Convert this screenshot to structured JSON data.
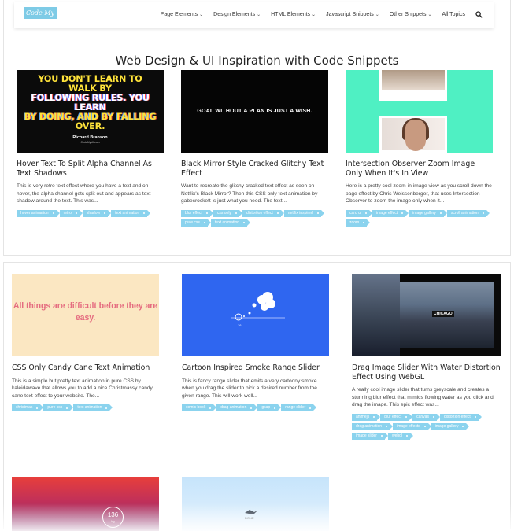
{
  "nav": {
    "logo": "Code My UI",
    "items": [
      {
        "label": "Page Elements",
        "dropdown": true
      },
      {
        "label": "Design Elements",
        "dropdown": true
      },
      {
        "label": "HTML Elements",
        "dropdown": true
      },
      {
        "label": "Javascript Snippets",
        "dropdown": true
      },
      {
        "label": "Other Snippets",
        "dropdown": true
      },
      {
        "label": "All Topics",
        "dropdown": false
      }
    ],
    "search_icon": "search-icon"
  },
  "page_title": "Web Design & UI Inspiration with Code Snippets",
  "cards": [
    {
      "title": "Hover Text To Split Alpha Channel As Text Shadows",
      "desc": "This is very retro text effect where you have a text and on hover, the alpha channel gets split out and appears as text shadow around the text. This was...",
      "tags": [
        "hover animation",
        "retro",
        "shadow",
        "text animation"
      ],
      "thumb": {
        "lines": [
          "YOU DON'T LEARN TO WALK BY",
          "FOLLOWING RULES. YOU LEARN",
          "BY DOING, AND BY FALLING",
          "OVER."
        ],
        "author": "Richard Branson",
        "site": "CodeMyUI.com"
      }
    },
    {
      "title": "Black Mirror Style Cracked Glitchy Text Effect",
      "desc": "Want to recreate the glitchy cracked text effect as seen on Netflix's Black Mirror? Then this CSS only text animation by gabecrockett is just what you need. The text...",
      "tags": [
        "blur effect",
        "css only",
        "distortion effect",
        "netflix inspired",
        "pure css",
        "text animation"
      ],
      "thumb": {
        "text": "GOAL WITHOUT A PLAN IS JUST A WISH."
      }
    },
    {
      "title": "Intersection Observer Zoom Image Only When It's In View",
      "desc": "Here is a pretty cool zoom-in image view as you scroll down the page effect by Chris Weissenberger, that uses Intersection Observer to zoom the image only when it...",
      "tags": [
        "card ui",
        "image effect",
        "image gallery",
        "scroll animation",
        "zoom"
      ]
    },
    {
      "title": "CSS Only Candy Cane Text Animation",
      "desc": "This is a simple but pretty text animation in pure CSS by kaleidawave that allows you to add a nice Christmassy candy cane text effect to your website. The...",
      "tags": [
        "christmas",
        "pure css",
        "text animation"
      ],
      "thumb": {
        "text": "All things are difficult before they are easy."
      }
    },
    {
      "title": "Cartoon Inspired Smoke Range Slider",
      "desc": "This is fancy range slider that emits a very cartoony smoke when you drag the slider to pick a desired number from the given range. This will work well...",
      "tags": [
        "comic book",
        "drag animation",
        "gsap",
        "range slider"
      ],
      "thumb": {
        "value": "16"
      }
    },
    {
      "title": "Drag Image Slider With Water Distortion Effect Using WebGL",
      "desc": "A really cool image slider that turns greyscale and creates a stunning blur effect that mimics flowing water as you click and drag the image. This epic effect was...",
      "tags": [
        "animejs",
        "blur effect",
        "canvas",
        "distortion effect",
        "drag animation",
        "image effects",
        "image gallery",
        "image slider",
        "webgl"
      ],
      "thumb": {
        "label": "CHICAGO"
      }
    },
    {
      "thumb": {
        "value": "136",
        "unit": "kg"
      }
    },
    {
      "thumb": {
        "label": "DONE"
      }
    }
  ]
}
